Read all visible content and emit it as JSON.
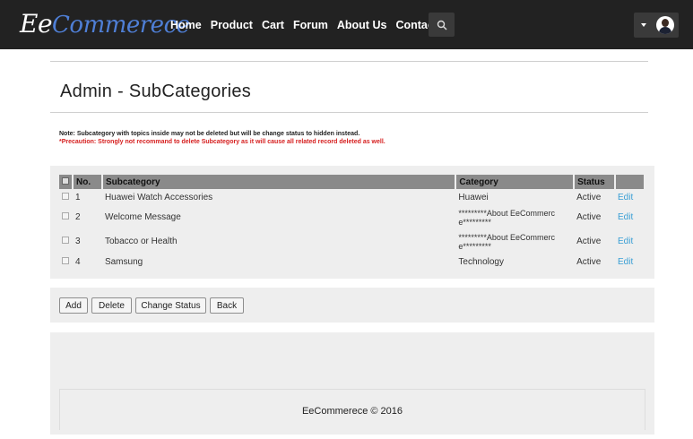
{
  "navbar": {
    "brand_first": "Ee",
    "brand_rest": "Commerece",
    "links": [
      "Home",
      "Product",
      "Cart",
      "Forum",
      "About Us",
      "Contact Us"
    ]
  },
  "page": {
    "title": "Admin - SubCategories",
    "note": "Note: Subcategory with topics inside may not be deleted but will be change status to hidden instead.",
    "precaution": "*Precaution: Strongly not recommand to delete Subcategory as it will cause all related record deleted as well."
  },
  "table": {
    "headers": {
      "no": "No.",
      "subcategory": "Subcategory",
      "category": "Category",
      "status": "Status"
    },
    "rows": [
      {
        "no": "1",
        "subcategory": "Huawei Watch Accessories",
        "category_line1": "Huawei",
        "category_line2": "",
        "status": "Active",
        "action": "Edit"
      },
      {
        "no": "2",
        "subcategory": "Welcome Message",
        "category_line1": "*********About EeCommerc",
        "category_line2": "e*********",
        "status": "Active",
        "action": "Edit"
      },
      {
        "no": "3",
        "subcategory": "Tobacco or Health",
        "category_line1": "*********About EeCommerc",
        "category_line2": "e*********",
        "status": "Active",
        "action": "Edit"
      },
      {
        "no": "4",
        "subcategory": "Samsung",
        "category_line1": "Technology",
        "category_line2": "",
        "status": "Active",
        "action": "Edit"
      }
    ]
  },
  "buttons": {
    "add": "Add",
    "delete": "Delete",
    "change_status": "Change Status",
    "back": "Back"
  },
  "footer": {
    "text": "EeCommerece © 2016"
  },
  "colors": {
    "navbar": "#222222",
    "brand": "#4f7fd6",
    "precaution": "#d62020",
    "edit_link": "#3a9fd5",
    "table_header": "#8a8a8a"
  }
}
